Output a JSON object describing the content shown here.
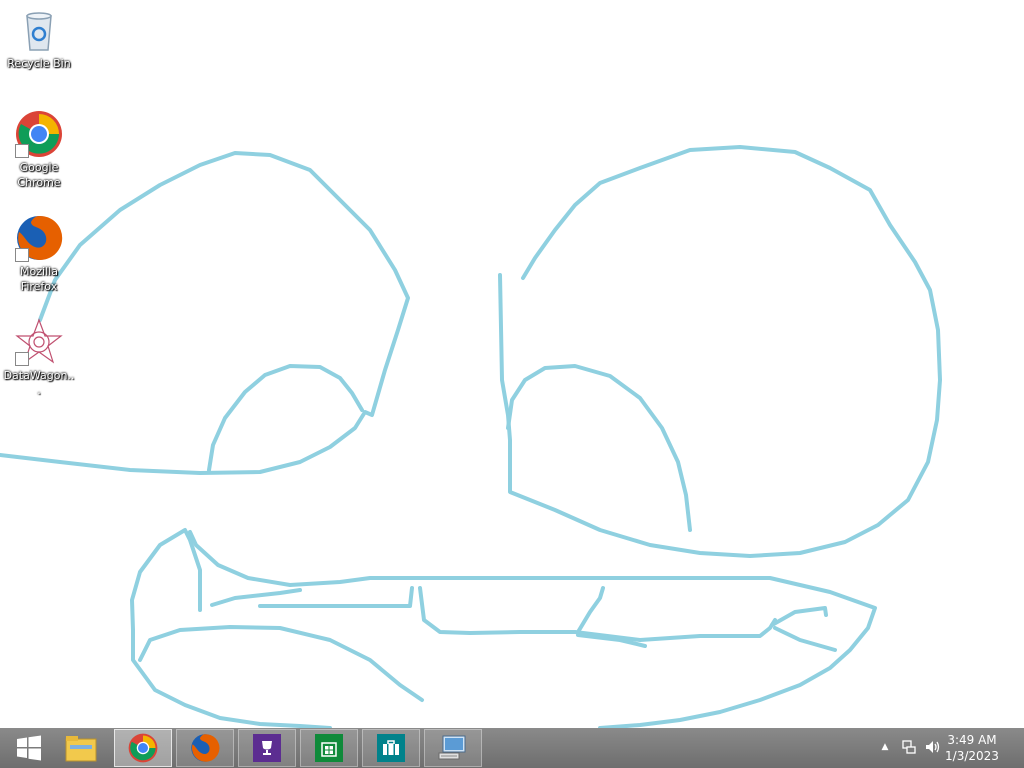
{
  "desktop": {
    "icons": [
      {
        "label": "Recycle Bin"
      },
      {
        "label": "Google Chrome"
      },
      {
        "label": "Mozilla Firefox"
      },
      {
        "label": "DataWagon..."
      }
    ],
    "stroke_color": "#8fd0e0"
  },
  "taskbar": {
    "start_icon": "windows-logo-icon",
    "pinned": [
      {
        "name": "file-explorer-icon"
      },
      {
        "name": "chrome-icon"
      },
      {
        "name": "firefox-icon"
      },
      {
        "name": "trophy-app-icon"
      },
      {
        "name": "store-icon"
      },
      {
        "name": "briefcase-app-icon"
      },
      {
        "name": "remote-desktop-icon"
      }
    ],
    "tray": {
      "show_hidden": "▲",
      "clock": {
        "time": "3:49 AM",
        "date": "1/3/2023"
      }
    }
  }
}
